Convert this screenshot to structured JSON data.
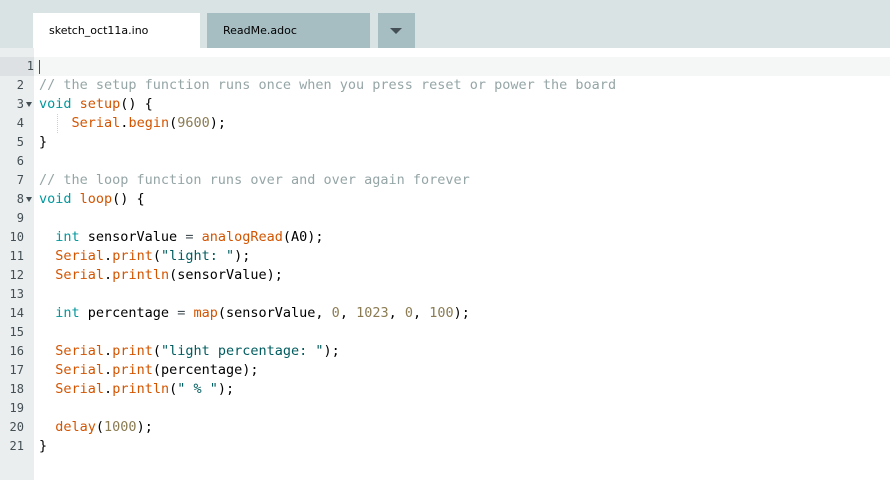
{
  "tabs": [
    {
      "label": "sketch_oct11a.ino",
      "active": true
    },
    {
      "label": "ReadMe.adoc",
      "active": false
    }
  ],
  "tab_menu_icon": "chevron-down-icon",
  "colors": {
    "comment": "#95a5a6",
    "keyword": "#00979c",
    "function": "#d35400",
    "number": "#8a7b52",
    "string": "#005c5f"
  },
  "editor": {
    "active_line": 1,
    "lines": [
      {
        "n": "1",
        "tokens": []
      },
      {
        "n": "2",
        "tokens": [
          {
            "t": "// the setup function runs once when you press reset or power the board",
            "c": "com"
          }
        ]
      },
      {
        "n": "3",
        "fold": true,
        "tokens": [
          {
            "t": "void",
            "c": "type"
          },
          {
            "t": " "
          },
          {
            "t": "setup",
            "c": "fn"
          },
          {
            "t": "() {"
          }
        ]
      },
      {
        "n": "4",
        "tokens": [
          {
            "t": "    "
          },
          {
            "t": "Serial",
            "c": "fn"
          },
          {
            "t": "."
          },
          {
            "t": "begin",
            "c": "fn"
          },
          {
            "t": "("
          },
          {
            "t": "9600",
            "c": "num"
          },
          {
            "t": ");"
          }
        ]
      },
      {
        "n": "5",
        "tokens": [
          {
            "t": "}"
          }
        ]
      },
      {
        "n": "6",
        "tokens": []
      },
      {
        "n": "7",
        "tokens": [
          {
            "t": "// the loop function runs over and over again forever",
            "c": "com"
          }
        ]
      },
      {
        "n": "8",
        "fold": true,
        "tokens": [
          {
            "t": "void",
            "c": "type"
          },
          {
            "t": " "
          },
          {
            "t": "loop",
            "c": "fn"
          },
          {
            "t": "() {"
          }
        ]
      },
      {
        "n": "9",
        "tokens": []
      },
      {
        "n": "10",
        "tokens": [
          {
            "t": "  "
          },
          {
            "t": "int",
            "c": "type"
          },
          {
            "t": " sensorValue "
          },
          {
            "t": "=",
            "c": "op"
          },
          {
            "t": " "
          },
          {
            "t": "analogRead",
            "c": "fn"
          },
          {
            "t": "(A0);"
          }
        ]
      },
      {
        "n": "11",
        "tokens": [
          {
            "t": "  "
          },
          {
            "t": "Serial",
            "c": "fn"
          },
          {
            "t": "."
          },
          {
            "t": "print",
            "c": "fn"
          },
          {
            "t": "("
          },
          {
            "t": "\"light: \"",
            "c": "str"
          },
          {
            "t": ");"
          }
        ]
      },
      {
        "n": "12",
        "tokens": [
          {
            "t": "  "
          },
          {
            "t": "Serial",
            "c": "fn"
          },
          {
            "t": "."
          },
          {
            "t": "println",
            "c": "fn"
          },
          {
            "t": "(sensorValue);"
          }
        ]
      },
      {
        "n": "13",
        "tokens": []
      },
      {
        "n": "14",
        "tokens": [
          {
            "t": "  "
          },
          {
            "t": "int",
            "c": "type"
          },
          {
            "t": " percentage "
          },
          {
            "t": "=",
            "c": "op"
          },
          {
            "t": " "
          },
          {
            "t": "map",
            "c": "fn"
          },
          {
            "t": "(sensorValue, "
          },
          {
            "t": "0",
            "c": "num"
          },
          {
            "t": ", "
          },
          {
            "t": "1023",
            "c": "num"
          },
          {
            "t": ", "
          },
          {
            "t": "0",
            "c": "num"
          },
          {
            "t": ", "
          },
          {
            "t": "100",
            "c": "num"
          },
          {
            "t": ");"
          }
        ]
      },
      {
        "n": "15",
        "tokens": []
      },
      {
        "n": "16",
        "tokens": [
          {
            "t": "  "
          },
          {
            "t": "Serial",
            "c": "fn"
          },
          {
            "t": "."
          },
          {
            "t": "print",
            "c": "fn"
          },
          {
            "t": "("
          },
          {
            "t": "\"light percentage: \"",
            "c": "str"
          },
          {
            "t": ");"
          }
        ]
      },
      {
        "n": "17",
        "tokens": [
          {
            "t": "  "
          },
          {
            "t": "Serial",
            "c": "fn"
          },
          {
            "t": "."
          },
          {
            "t": "print",
            "c": "fn"
          },
          {
            "t": "(percentage);"
          }
        ]
      },
      {
        "n": "18",
        "tokens": [
          {
            "t": "  "
          },
          {
            "t": "Serial",
            "c": "fn"
          },
          {
            "t": "."
          },
          {
            "t": "println",
            "c": "fn"
          },
          {
            "t": "("
          },
          {
            "t": "\" % \"",
            "c": "str"
          },
          {
            "t": ");"
          }
        ]
      },
      {
        "n": "19",
        "tokens": []
      },
      {
        "n": "20",
        "tokens": [
          {
            "t": "  "
          },
          {
            "t": "delay",
            "c": "fn"
          },
          {
            "t": "("
          },
          {
            "t": "1000",
            "c": "num"
          },
          {
            "t": ");"
          }
        ]
      },
      {
        "n": "21",
        "tokens": [
          {
            "t": "}"
          }
        ]
      }
    ]
  }
}
